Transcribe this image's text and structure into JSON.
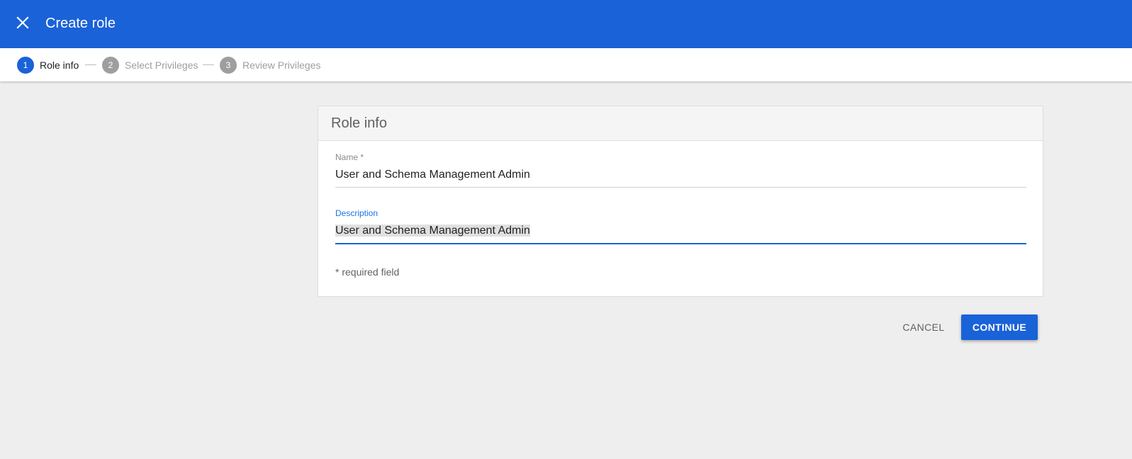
{
  "appbar": {
    "title": "Create role",
    "close_icon": "close-icon",
    "color": "#1a62d8"
  },
  "stepper": {
    "steps": [
      {
        "number": "1",
        "label": "Role info",
        "active": true
      },
      {
        "number": "2",
        "label": "Select Privileges",
        "active": false
      },
      {
        "number": "3",
        "label": "Review Privileges",
        "active": false
      }
    ]
  },
  "card": {
    "title": "Role info",
    "name_field": {
      "label": "Name *",
      "value": "User and Schema Management Admin"
    },
    "description_field": {
      "label": "Description",
      "value": "User and Schema Management Admin"
    },
    "required_note": "* required field"
  },
  "actions": {
    "cancel_label": "CANCEL",
    "continue_label": "CONTINUE"
  }
}
